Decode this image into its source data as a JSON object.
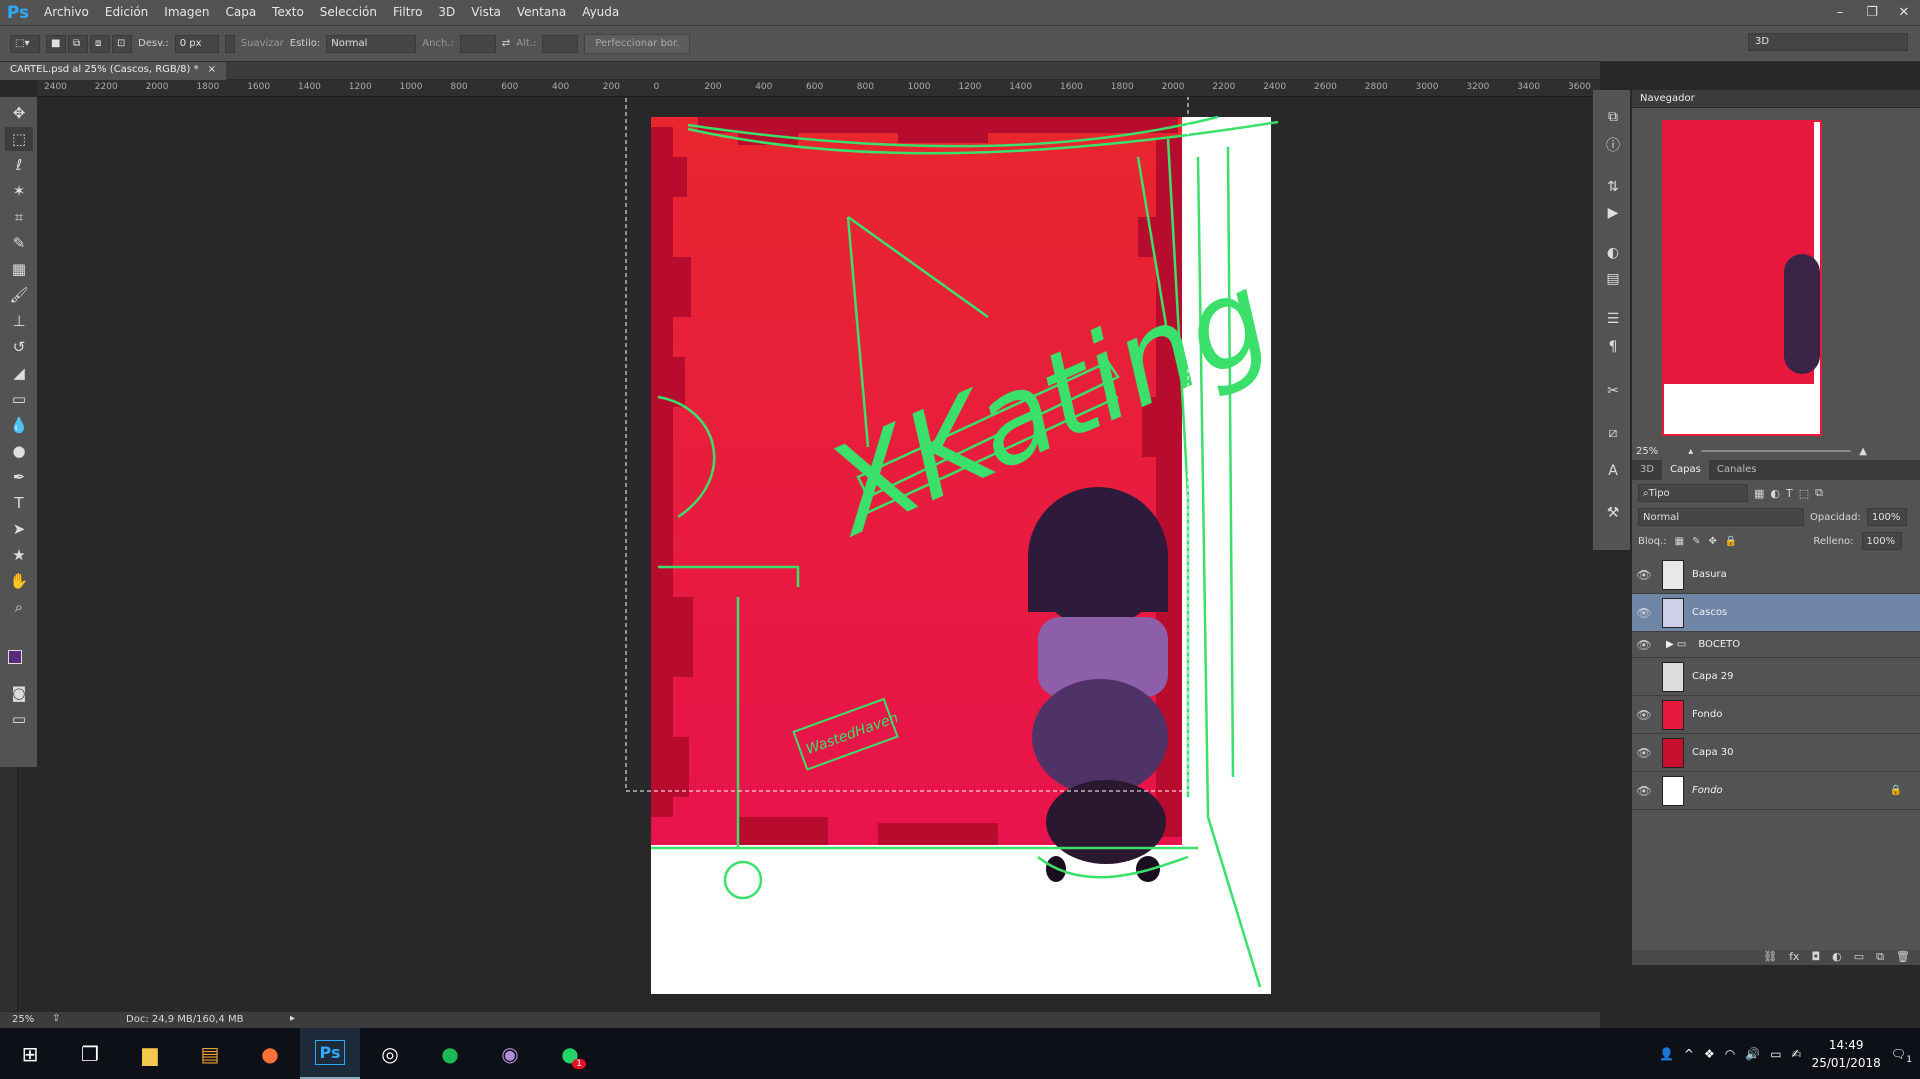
{
  "app": {
    "logo": "Ps"
  },
  "menu": [
    "Archivo",
    "Edición",
    "Imagen",
    "Capa",
    "Texto",
    "Selección",
    "Filtro",
    "3D",
    "Vista",
    "Ventana",
    "Ayuda"
  ],
  "window_controls": {
    "minimize": "–",
    "restore": "❐",
    "close": "✕"
  },
  "options": {
    "desv_label": "Desv.:",
    "desv_value": "0 px",
    "suavizar_label": "Suavizar",
    "estilo_label": "Estilo:",
    "estilo_value": "Normal",
    "anch_label": "Anch.:",
    "alt_label": "Alt.:",
    "refine_button": "Perfeccionar bor.",
    "workspace_mode": "3D"
  },
  "document_tab": {
    "title": "CARTEL.psd al 25% (Cascos, RGB/8) *",
    "close": "×"
  },
  "ruler_labels": [
    "2400",
    "2200",
    "2000",
    "1800",
    "1600",
    "1400",
    "1200",
    "1000",
    "800",
    "600",
    "400",
    "200",
    "0",
    "200",
    "400",
    "600",
    "800",
    "1000",
    "1200",
    "1400",
    "1600",
    "1800",
    "2000",
    "2200",
    "2400",
    "2600",
    "2800",
    "3000",
    "3200",
    "3400",
    "3600"
  ],
  "status": {
    "zoom": "25%",
    "doc": "Doc: 24,9 MB/160,4 MB"
  },
  "navigator": {
    "title": "Navegador",
    "zoom": "25%"
  },
  "layers_panel": {
    "tabs": [
      "3D",
      "Capas",
      "Canales"
    ],
    "active_tab": "Capas",
    "filter": "Tipo",
    "blend_mode": "Normal",
    "opacity_label": "Opacidad:",
    "opacity_value": "100%",
    "lock_label": "Bloq.:",
    "fill_label": "Relleno:",
    "fill_value": "100%",
    "layers": [
      {
        "name": "Basura",
        "visible": true,
        "selected": false,
        "thumb": "#e8e8e8"
      },
      {
        "name": "Cascos",
        "visible": true,
        "selected": true,
        "thumb": "#cfcfe8"
      },
      {
        "name": "BOCETO",
        "visible": true,
        "selected": false,
        "group": true
      },
      {
        "name": "Capa 29",
        "visible": false,
        "selected": false,
        "thumb": "#dcdcdc"
      },
      {
        "name": "Fondo",
        "visible": true,
        "selected": false,
        "thumb": "#e8193c"
      },
      {
        "name": "Capa 30",
        "visible": true,
        "selected": false,
        "thumb": "#c8102e"
      },
      {
        "name": "Fondo",
        "visible": true,
        "selected": false,
        "thumb": "#ffffff",
        "italic": true,
        "locked": true
      }
    ]
  },
  "canvas": {
    "title_sketch": "XKating",
    "stamp_sketch": "WastedHaven"
  },
  "taskbar": {
    "apps": [
      "start",
      "task-view",
      "explorer",
      "sublime",
      "firefox",
      "photoshop",
      "steam",
      "spotify",
      "github",
      "whatsapp"
    ],
    "whatsapp_badge": "1",
    "time": "14:49",
    "date": "25/01/2018",
    "notif_badge": "1"
  },
  "colors": {
    "accent_red": "#e8193c",
    "sketch_green": "#3be06a",
    "selection_blue": "#6f86a6"
  }
}
